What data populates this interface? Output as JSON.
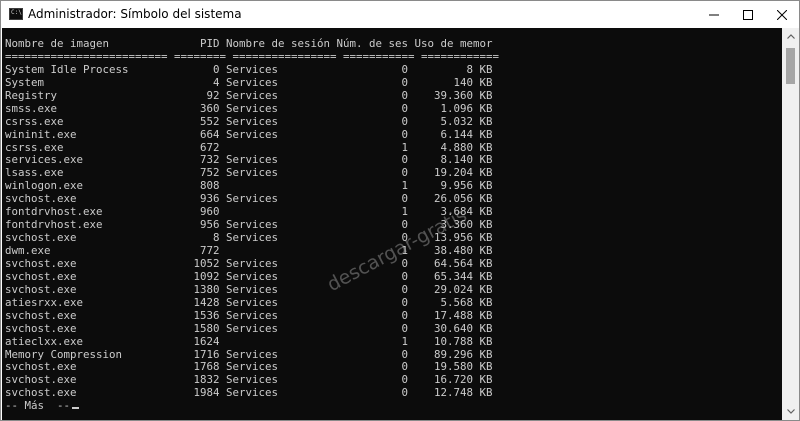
{
  "window": {
    "title": "Administrador: Símbolo del sistema",
    "icon": "cmd-icon",
    "icon_text": "C:\\"
  },
  "controls": {
    "minimize": "minimize-icon",
    "maximize": "maximize-icon",
    "close": "close-icon"
  },
  "console": {
    "header": "Nombre de imagen              PID Nombre de sesión Núm. de ses Uso de memor",
    "separator": "========================= ======== ================ =========== ============",
    "rows": [
      "System Idle Process             0 Services                   0         8 KB",
      "System                          4 Services                   0       140 KB",
      "Registry                       92 Services                   0    39.360 KB",
      "smss.exe                      360 Services                   0     1.096 KB",
      "csrss.exe                     552 Services                   0     5.032 KB",
      "wininit.exe                   664 Services                   0     6.144 KB",
      "csrss.exe                     672                            1     4.880 KB",
      "services.exe                  732 Services                   0     8.140 KB",
      "lsass.exe                     752 Services                   0    19.204 KB",
      "winlogon.exe                  808                            1     9.956 KB",
      "svchost.exe                   936 Services                   0    26.056 KB",
      "fontdrvhost.exe               960                            1     3.684 KB",
      "fontdrvhost.exe               956 Services                   0     3.360 KB",
      "svchost.exe                     8 Services                   0    13.956 KB",
      "dwm.exe                       772                            1    38.480 KB",
      "svchost.exe                  1052 Services                   0    64.564 KB",
      "svchost.exe                  1092 Services                   0    65.344 KB",
      "svchost.exe                  1380 Services                   0    29.024 KB",
      "atiesrxx.exe                 1428 Services                   0     5.568 KB",
      "svchost.exe                  1536 Services                   0    17.488 KB",
      "svchost.exe                  1580 Services                   0    30.640 KB",
      "atieclxx.exe                 1624                            1    10.788 KB",
      "Memory Compression           1716 Services                   0    89.296 KB",
      "svchost.exe                  1768 Services                   0    19.580 KB",
      "svchost.exe                  1832 Services                   0    16.720 KB",
      "svchost.exe                  1984 Services                   0    12.748 KB"
    ],
    "more_prompt": "-- Más  --"
  },
  "watermark": "descargar-gratis",
  "colors": {
    "console_bg": "#0c0c0c",
    "console_text": "#cccccc",
    "titlebar_bg": "#ffffff",
    "scrollbar_bg": "#f0f0f0",
    "scrollbar_thumb": "#a6a6a6"
  }
}
